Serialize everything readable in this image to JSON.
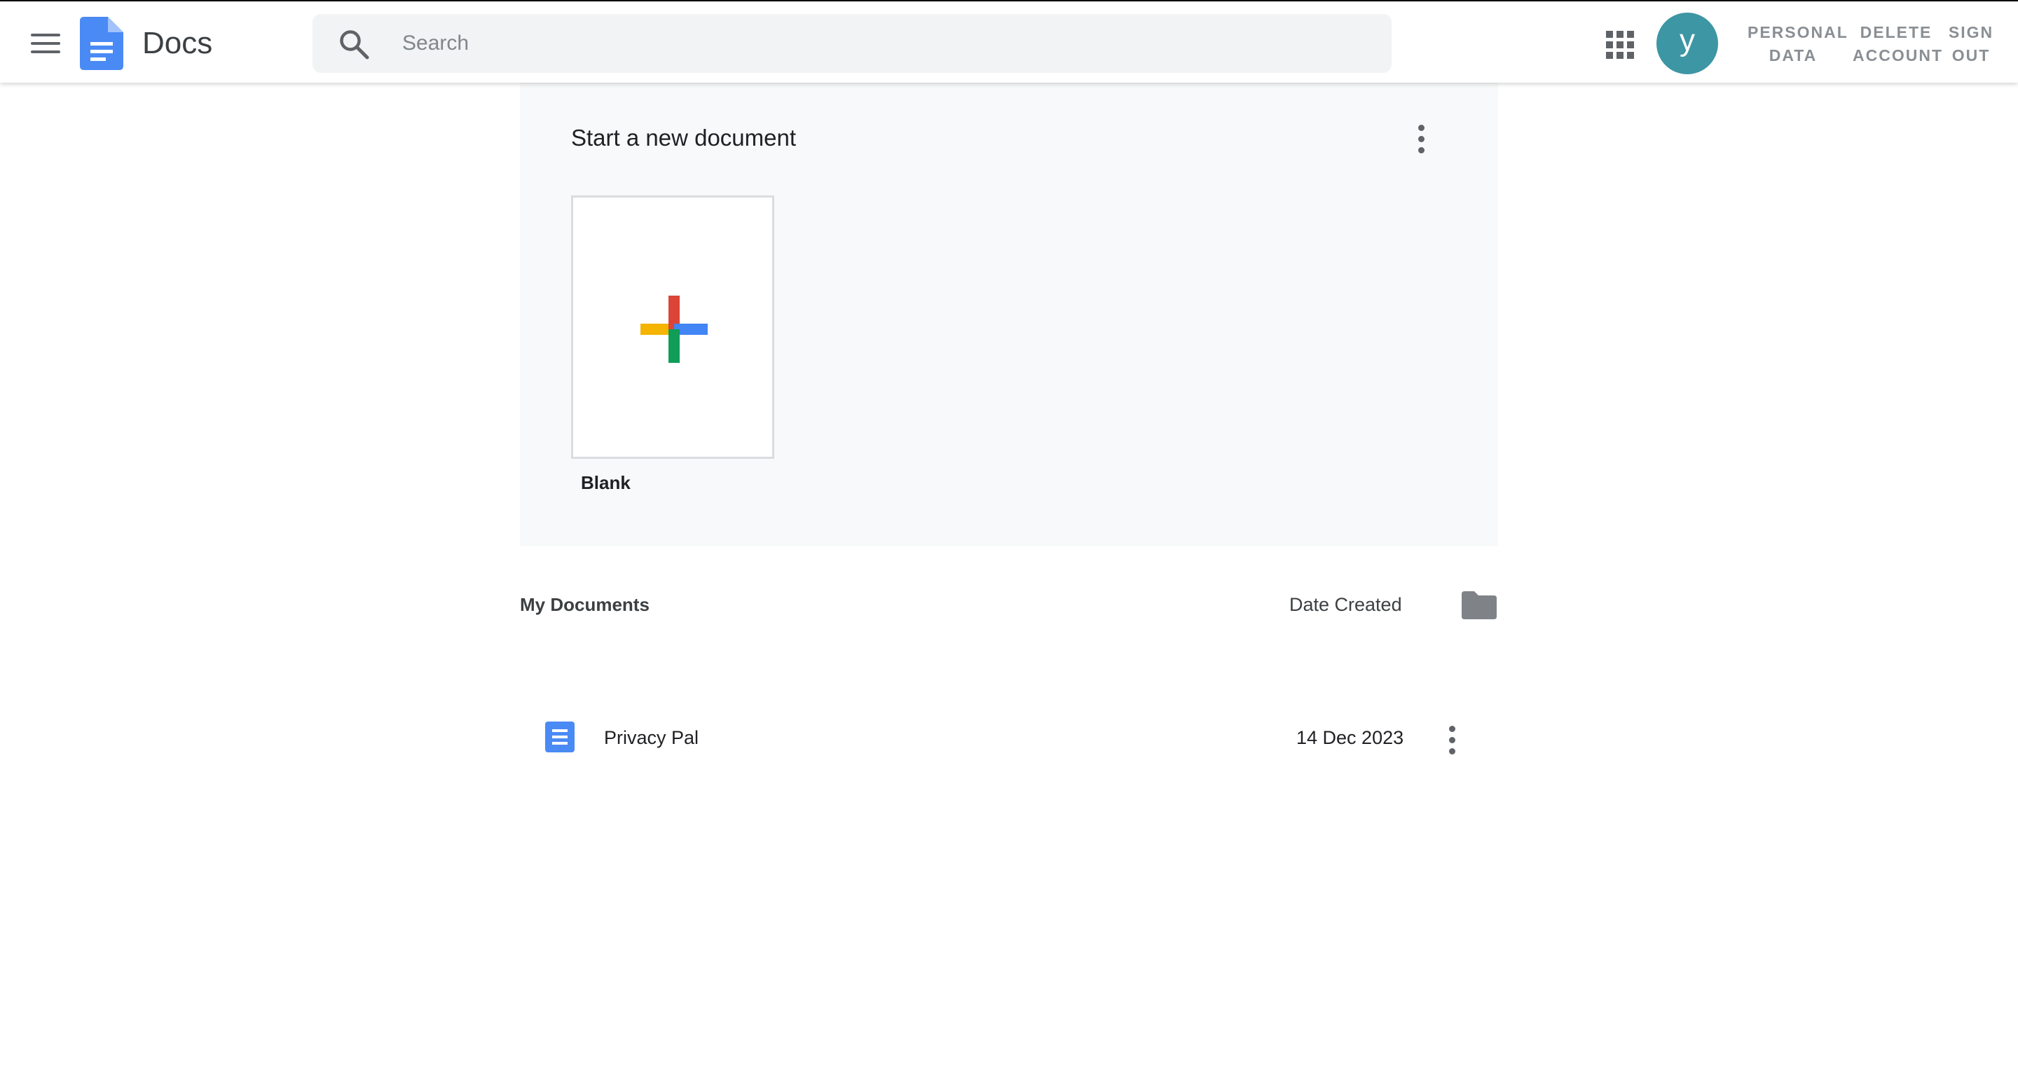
{
  "header": {
    "app_title": "Docs",
    "search": {
      "placeholder": "Search",
      "value": ""
    },
    "avatar_letter": "y",
    "links": [
      {
        "line1": "PERSONAL",
        "line2": "DATA"
      },
      {
        "line1": "DELETE",
        "line2": "ACCOUNT"
      },
      {
        "line1": "SIGN",
        "line2": "OUT"
      }
    ],
    "icons": {
      "menu": "hamburger-menu-icon",
      "logo": "docs-logo-icon",
      "search": "search-icon",
      "apps": "apps-grid-icon"
    }
  },
  "new_document": {
    "title": "Start a new document",
    "templates": [
      {
        "label": "Blank",
        "icon": "colorful-plus-icon"
      }
    ]
  },
  "documents": {
    "title": "My Documents",
    "sort_label": "Date Created",
    "items": [
      {
        "name": "Privacy Pal",
        "date": "14 Dec 2023",
        "icon": "document-icon"
      }
    ]
  },
  "colors": {
    "brand_blue": "#4a8af4",
    "avatar_bg": "#3d96a3",
    "plus_red": "#db4437",
    "plus_blue": "#4285f4",
    "plus_green": "#0f9d58",
    "plus_yellow": "#f4b400"
  }
}
